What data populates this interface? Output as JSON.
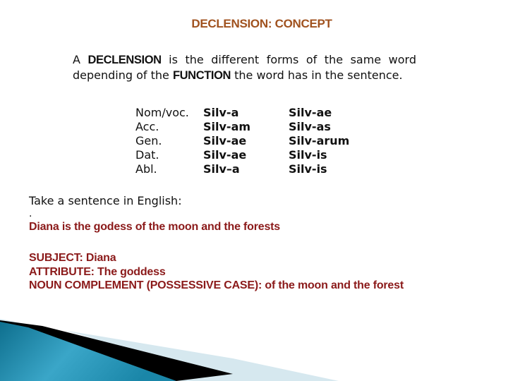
{
  "slide": {
    "title": "DECLENSION: CONCEPT",
    "definition": {
      "part1": "A ",
      "term1": "DECLENSION",
      "part2": " is the different forms of the same word depending of the ",
      "term2": "FUNCTION",
      "part3": " the word has in the sentence."
    },
    "declension_table": {
      "rows": [
        {
          "case": "Nom/voc.",
          "singular": "Silv-a",
          "plural": "Silv-ae"
        },
        {
          "case": "Acc.",
          "singular": "Silv-am",
          "plural": "Silv-as"
        },
        {
          "case": "Gen.",
          "singular": "Silv-ae",
          "plural": "Silv-arum"
        },
        {
          "case": "Dat.",
          "singular": "Silv-ae",
          "plural": "Silv-is"
        },
        {
          "case": "Abl.",
          "singular": "Silv–a",
          "plural": "Silv-is"
        }
      ]
    },
    "example": {
      "intro": "Take a sentence in English:",
      "dot": ".",
      "sentence": "Diana is the godess of the moon and the forests"
    },
    "analysis": [
      "SUBJECT: Diana",
      "ATTRIBUTE: The goddess",
      "NOUN COMPLEMENT (POSSESSIVE CASE): of the moon and the forest"
    ]
  },
  "colors": {
    "title": "#a0521f",
    "highlight_red": "#8b1a1a",
    "decor_teal": "#1a86a8",
    "decor_light": "#d6e8ef"
  }
}
